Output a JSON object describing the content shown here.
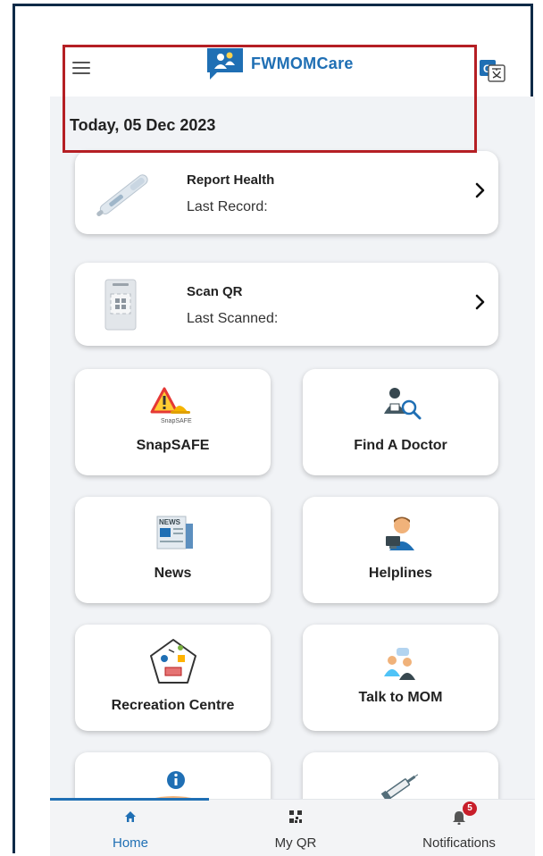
{
  "header": {
    "app_name": "FWMOMCare",
    "menu_icon": "hamburger-icon",
    "translate_icon": "translate-icon",
    "logo_icon": "fwmomcare-logo-icon"
  },
  "date_label": "Today, 05 Dec 2023",
  "cards": {
    "report_health": {
      "title": "Report Health",
      "subtitle": "Last Record:",
      "icon": "thermometer-icon",
      "chevron": "chevron-right-icon"
    },
    "scan_qr": {
      "title": "Scan QR",
      "subtitle": "Last Scanned:",
      "icon": "qr-scanner-icon",
      "chevron": "chevron-right-icon"
    }
  },
  "tiles": [
    {
      "label": "SnapSAFE",
      "icon": "warning-hardhat-icon",
      "icon_caption": "SnapSAFE"
    },
    {
      "label": "Find A Doctor",
      "icon": "doctor-search-icon"
    },
    {
      "label": "News",
      "icon": "newspaper-icon",
      "icon_caption": "NEWS"
    },
    {
      "label": "Helplines",
      "icon": "helpline-agent-icon"
    },
    {
      "label": "Recreation Centre",
      "icon": "recreation-centre-icon"
    },
    {
      "label": "Talk to MOM",
      "icon": "chat-people-icon"
    },
    {
      "label": "",
      "icon": "info-hand-icon"
    },
    {
      "label": "",
      "icon": "syringe-icon"
    }
  ],
  "bottom_nav": {
    "items": [
      {
        "label": "Home",
        "icon": "home-icon",
        "active": true
      },
      {
        "label": "My QR",
        "icon": "qr-code-icon",
        "active": false
      },
      {
        "label": "Notifications",
        "icon": "bell-icon",
        "active": false,
        "badge": "5"
      }
    ]
  },
  "colors": {
    "brand": "#1f6fb4",
    "highlight": "#b51f24",
    "background": "#f1f3f6",
    "badge": "#c81e2a"
  }
}
